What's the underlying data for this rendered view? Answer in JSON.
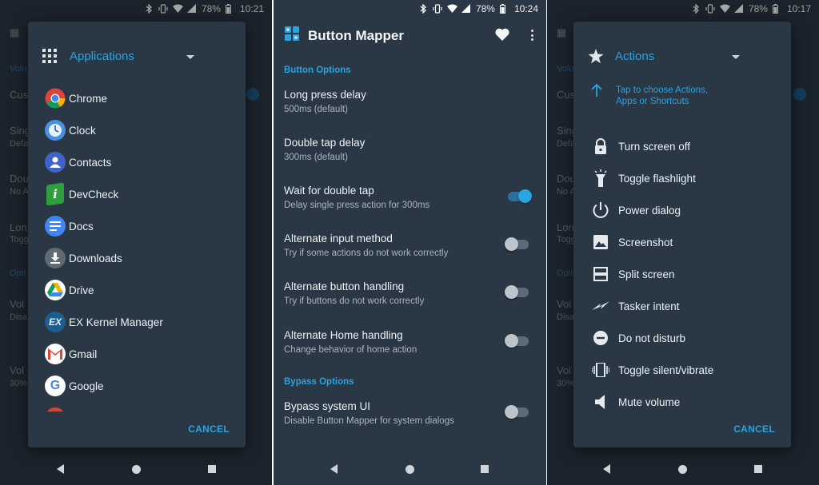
{
  "status_bars": [
    {
      "battery": "78%",
      "time": "10:21"
    },
    {
      "battery": "78%",
      "time": "10:24"
    },
    {
      "battery": "78%",
      "time": "10:17"
    }
  ],
  "left_panel": {
    "bg_fragments": [
      "Volu",
      "Cus",
      "Sing",
      "Defa",
      "Dou",
      "No A",
      "Lon",
      "Togg",
      "Opti",
      "Vol",
      "Disa",
      "Vol",
      "30%"
    ],
    "dialog": {
      "title": "Applications",
      "cancel_label": "CANCEL",
      "apps": [
        {
          "label": "Chrome",
          "icon": "chrome-icon",
          "color": "#ffffff"
        },
        {
          "label": "Clock",
          "icon": "clock-icon",
          "color": "#4a90e2"
        },
        {
          "label": "Contacts",
          "icon": "contacts-icon",
          "color": "#3f63c8"
        },
        {
          "label": "DevCheck",
          "icon": "devcheck-icon",
          "color": "#2e9e3e"
        },
        {
          "label": "Docs",
          "icon": "docs-icon",
          "color": "#4285f4"
        },
        {
          "label": "Downloads",
          "icon": "downloads-icon",
          "color": "#606a73"
        },
        {
          "label": "Drive",
          "icon": "drive-icon",
          "color": "#ffffff"
        },
        {
          "label": "EX Kernel Manager",
          "icon": "ex-kernel-icon",
          "color": "#1d5d8f"
        },
        {
          "label": "Gmail",
          "icon": "gmail-icon",
          "color": "#ffffff"
        },
        {
          "label": "Google",
          "icon": "google-icon",
          "color": "#ffffff"
        }
      ]
    }
  },
  "middle_panel": {
    "app_title": "Button Mapper",
    "sections": [
      {
        "header": "Button Options"
      },
      {
        "header": "Bypass Options"
      }
    ],
    "prefs": [
      {
        "title": "Long press delay",
        "summary": "500ms (default)",
        "toggle": null
      },
      {
        "title": "Double tap delay",
        "summary": "300ms (default)",
        "toggle": null
      },
      {
        "title": "Wait for double tap",
        "summary": "Delay single press action for 300ms",
        "toggle": true
      },
      {
        "title": "Alternate input method",
        "summary": "Try if some actions do not work correctly",
        "toggle": false
      },
      {
        "title": "Alternate button handling",
        "summary": "Try if buttons do not work correctly",
        "toggle": false
      },
      {
        "title": "Alternate Home handling",
        "summary": "Change behavior of home action",
        "toggle": false
      },
      {
        "title": "Bypass system UI",
        "summary": "Disable Button Mapper for system dialogs",
        "toggle": false
      }
    ]
  },
  "right_panel": {
    "bg_fragments": [
      "Volu",
      "Cus",
      "Sing",
      "Defa",
      "Dou",
      "No A",
      "Lon",
      "Togg",
      "Opti",
      "Vol",
      "Disa",
      "Vol",
      "30%"
    ],
    "dialog": {
      "title": "Actions",
      "hint": "Tap to choose Actions, Apps or Shortcuts",
      "cancel_label": "CANCEL",
      "actions": [
        {
          "label": "Turn screen off",
          "icon": "lock-icon"
        },
        {
          "label": "Toggle flashlight",
          "icon": "flashlight-icon"
        },
        {
          "label": "Power dialog",
          "icon": "power-icon"
        },
        {
          "label": "Screenshot",
          "icon": "image-icon"
        },
        {
          "label": "Split screen",
          "icon": "split-screen-icon"
        },
        {
          "label": "Tasker intent",
          "icon": "tasker-icon"
        },
        {
          "label": "Do not disturb",
          "icon": "do-not-disturb-icon"
        },
        {
          "label": "Toggle silent/vibrate",
          "icon": "vibrate-icon"
        },
        {
          "label": "Mute volume",
          "icon": "mute-volume-icon"
        }
      ]
    }
  },
  "colors": {
    "background": "#2a3744",
    "accent": "#2aa3e0",
    "text": "#eef2f4",
    "subtext": "#aab4bd"
  }
}
